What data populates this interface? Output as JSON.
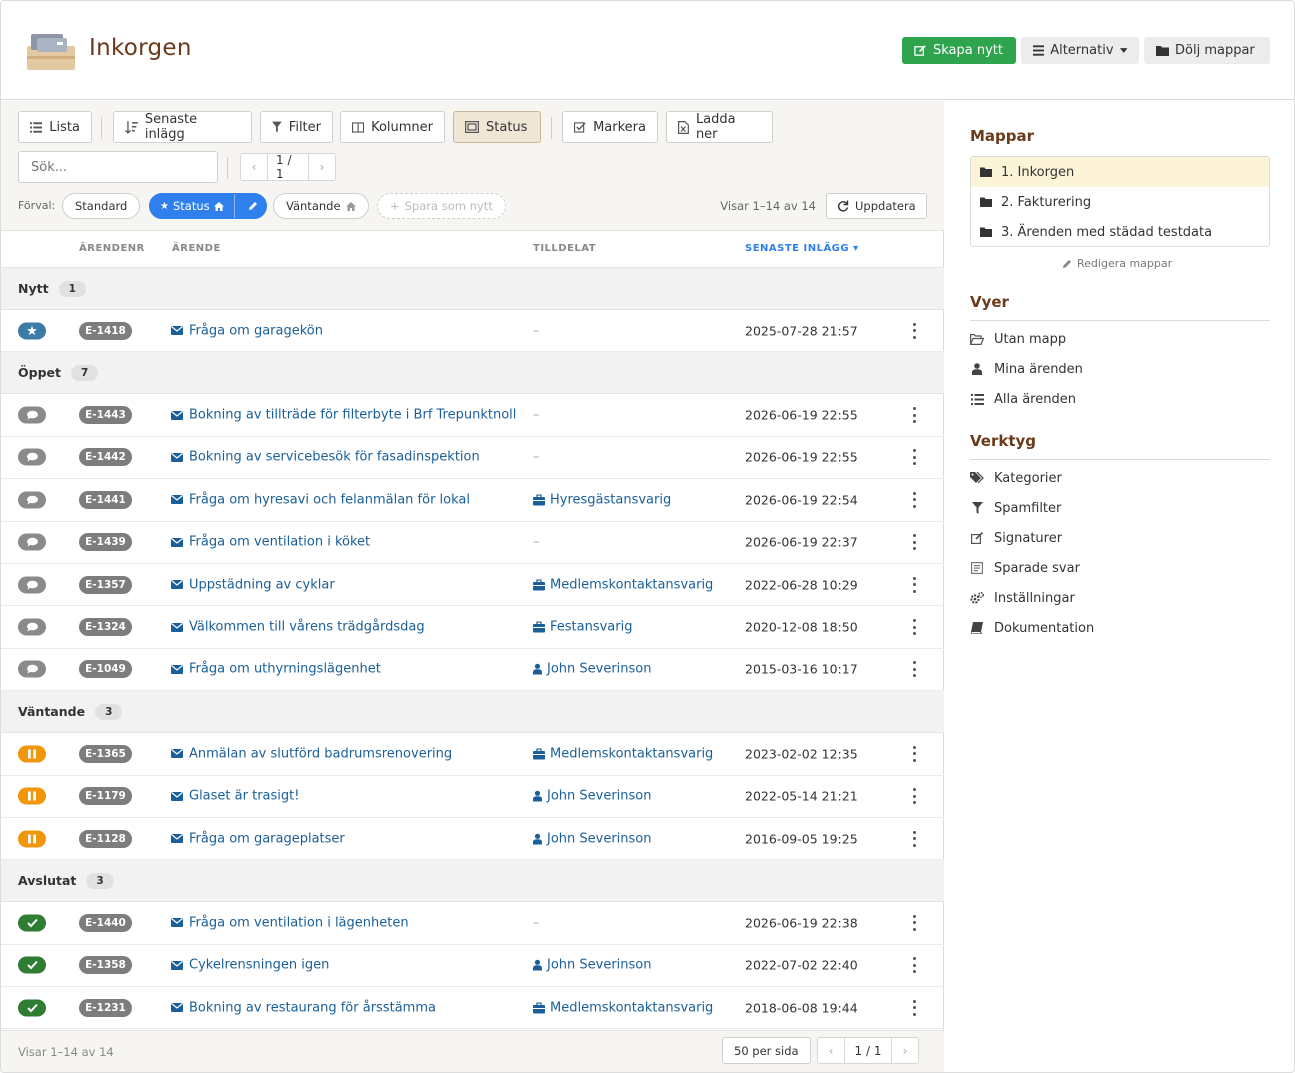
{
  "header": {
    "title": "Inkorgen",
    "btn_new": "Skapa nytt",
    "btn_options": "Alternativ",
    "btn_hide_folders": "Dölj mappar"
  },
  "toolbar": {
    "list": "Lista",
    "sort": "Senaste inlägg",
    "filter": "Filter",
    "columns": "Kolumner",
    "status": "Status",
    "select": "Markera",
    "download": "Ladda ner",
    "search_placeholder": "Sök...",
    "page": "1 / 1",
    "preset_label": "Förval:",
    "preset_standard": "Standard",
    "preset_status": "Status",
    "preset_waiting": "Väntande",
    "save_new": "Spara som nytt",
    "showing": "Visar 1–14 av 14",
    "refresh": "Uppdatera"
  },
  "columns": {
    "id": "ÄRENDENR",
    "subject": "ÄRENDE",
    "assigned": "TILLDELAT",
    "latest": "SENASTE INLÄGG"
  },
  "groups": [
    {
      "label": "Nytt",
      "count": "1",
      "rows": [
        {
          "status": "new",
          "id": "E-1418",
          "subject": "Fråga om garagekön",
          "assigned": "–",
          "atype": "none",
          "date": "2025-07-28 21:57"
        }
      ]
    },
    {
      "label": "Öppet",
      "count": "7",
      "rows": [
        {
          "status": "open",
          "id": "E-1443",
          "subject": "Bokning av tillträde för filterbyte i Brf Trepunktnoll",
          "assigned": "–",
          "atype": "none",
          "date": "2026-06-19 22:55"
        },
        {
          "status": "open",
          "id": "E-1442",
          "subject": "Bokning av servicebesök för fasadinspektion",
          "assigned": "–",
          "atype": "none",
          "date": "2026-06-19 22:55"
        },
        {
          "status": "open",
          "id": "E-1441",
          "subject": "Fråga om hyresavi och felanmälan för lokal",
          "assigned": "Hyresgästansvarig",
          "atype": "role",
          "date": "2026-06-19 22:54"
        },
        {
          "status": "open",
          "id": "E-1439",
          "subject": "Fråga om ventilation i köket",
          "assigned": "–",
          "atype": "none",
          "date": "2026-06-19 22:37"
        },
        {
          "status": "open",
          "id": "E-1357",
          "subject": "Uppstädning av cyklar",
          "assigned": "Medlemskontaktansvarig",
          "atype": "role",
          "date": "2022-06-28 10:29"
        },
        {
          "status": "open",
          "id": "E-1324",
          "subject": "Välkommen till vårens trädgårdsdag",
          "assigned": "Festansvarig",
          "atype": "role",
          "date": "2020-12-08 18:50"
        },
        {
          "status": "open",
          "id": "E-1049",
          "subject": "Fråga om uthyrningslägenhet",
          "assigned": "John Severinson",
          "atype": "user",
          "date": "2015-03-16 10:17"
        }
      ]
    },
    {
      "label": "Väntande",
      "count": "3",
      "rows": [
        {
          "status": "wait",
          "id": "E-1365",
          "subject": "Anmälan av slutförd badrumsrenovering",
          "assigned": "Medlemskontaktansvarig",
          "atype": "role",
          "date": "2023-02-02 12:35"
        },
        {
          "status": "wait",
          "id": "E-1179",
          "subject": "Glaset är trasigt!",
          "assigned": "John Severinson",
          "atype": "user",
          "date": "2022-05-14 21:21"
        },
        {
          "status": "wait",
          "id": "E-1128",
          "subject": "Fråga om garageplatser",
          "assigned": "John Severinson",
          "atype": "user",
          "date": "2016-09-05 19:25"
        }
      ]
    },
    {
      "label": "Avslutat",
      "count": "3",
      "rows": [
        {
          "status": "done",
          "id": "E-1440",
          "subject": "Fråga om ventilation i lägenheten",
          "assigned": "–",
          "atype": "none",
          "date": "2026-06-19 22:38"
        },
        {
          "status": "done",
          "id": "E-1358",
          "subject": "Cykelrensningen igen",
          "assigned": "John Severinson",
          "atype": "user",
          "date": "2022-07-02 22:40"
        },
        {
          "status": "done",
          "id": "E-1231",
          "subject": "Bokning av restaurang för årsstämma",
          "assigned": "Medlemskontaktansvarig",
          "atype": "role",
          "date": "2018-06-08 19:44"
        }
      ]
    }
  ],
  "footer": {
    "showing": "Visar 1–14 av 14",
    "per_page": "50 per sida",
    "page": "1 / 1"
  },
  "sidebar": {
    "folders_title": "Mappar",
    "folders": [
      "1. Inkorgen",
      "2. Fakturering",
      "3. Ärenden med städad testdata"
    ],
    "edit_folders": "Redigera mappar",
    "views_title": "Vyer",
    "views": [
      {
        "label": "Utan mapp",
        "icon": "folder-open-icon"
      },
      {
        "label": "Mina ärenden",
        "icon": "user-icon"
      },
      {
        "label": "Alla ärenden",
        "icon": "list-icon"
      }
    ],
    "tools_title": "Verktyg",
    "tools": [
      {
        "label": "Kategorier",
        "icon": "tags-icon"
      },
      {
        "label": "Spamfilter",
        "icon": "filter-icon"
      },
      {
        "label": "Signaturer",
        "icon": "edit-icon"
      },
      {
        "label": "Sparade svar",
        "icon": "saved-reply-icon"
      },
      {
        "label": "Inställningar",
        "icon": "cogs-icon"
      },
      {
        "label": "Dokumentation",
        "icon": "book-icon"
      }
    ]
  },
  "colors": {
    "brand_brown": "#6b3a1c",
    "green": "#2ea44f",
    "link_blue": "#1a5f99",
    "accent_blue": "#2f80ed",
    "status_new": "#3a7ca5",
    "status_open": "#8a8a8a",
    "status_wait": "#f0960b",
    "status_done": "#2e7d32"
  }
}
